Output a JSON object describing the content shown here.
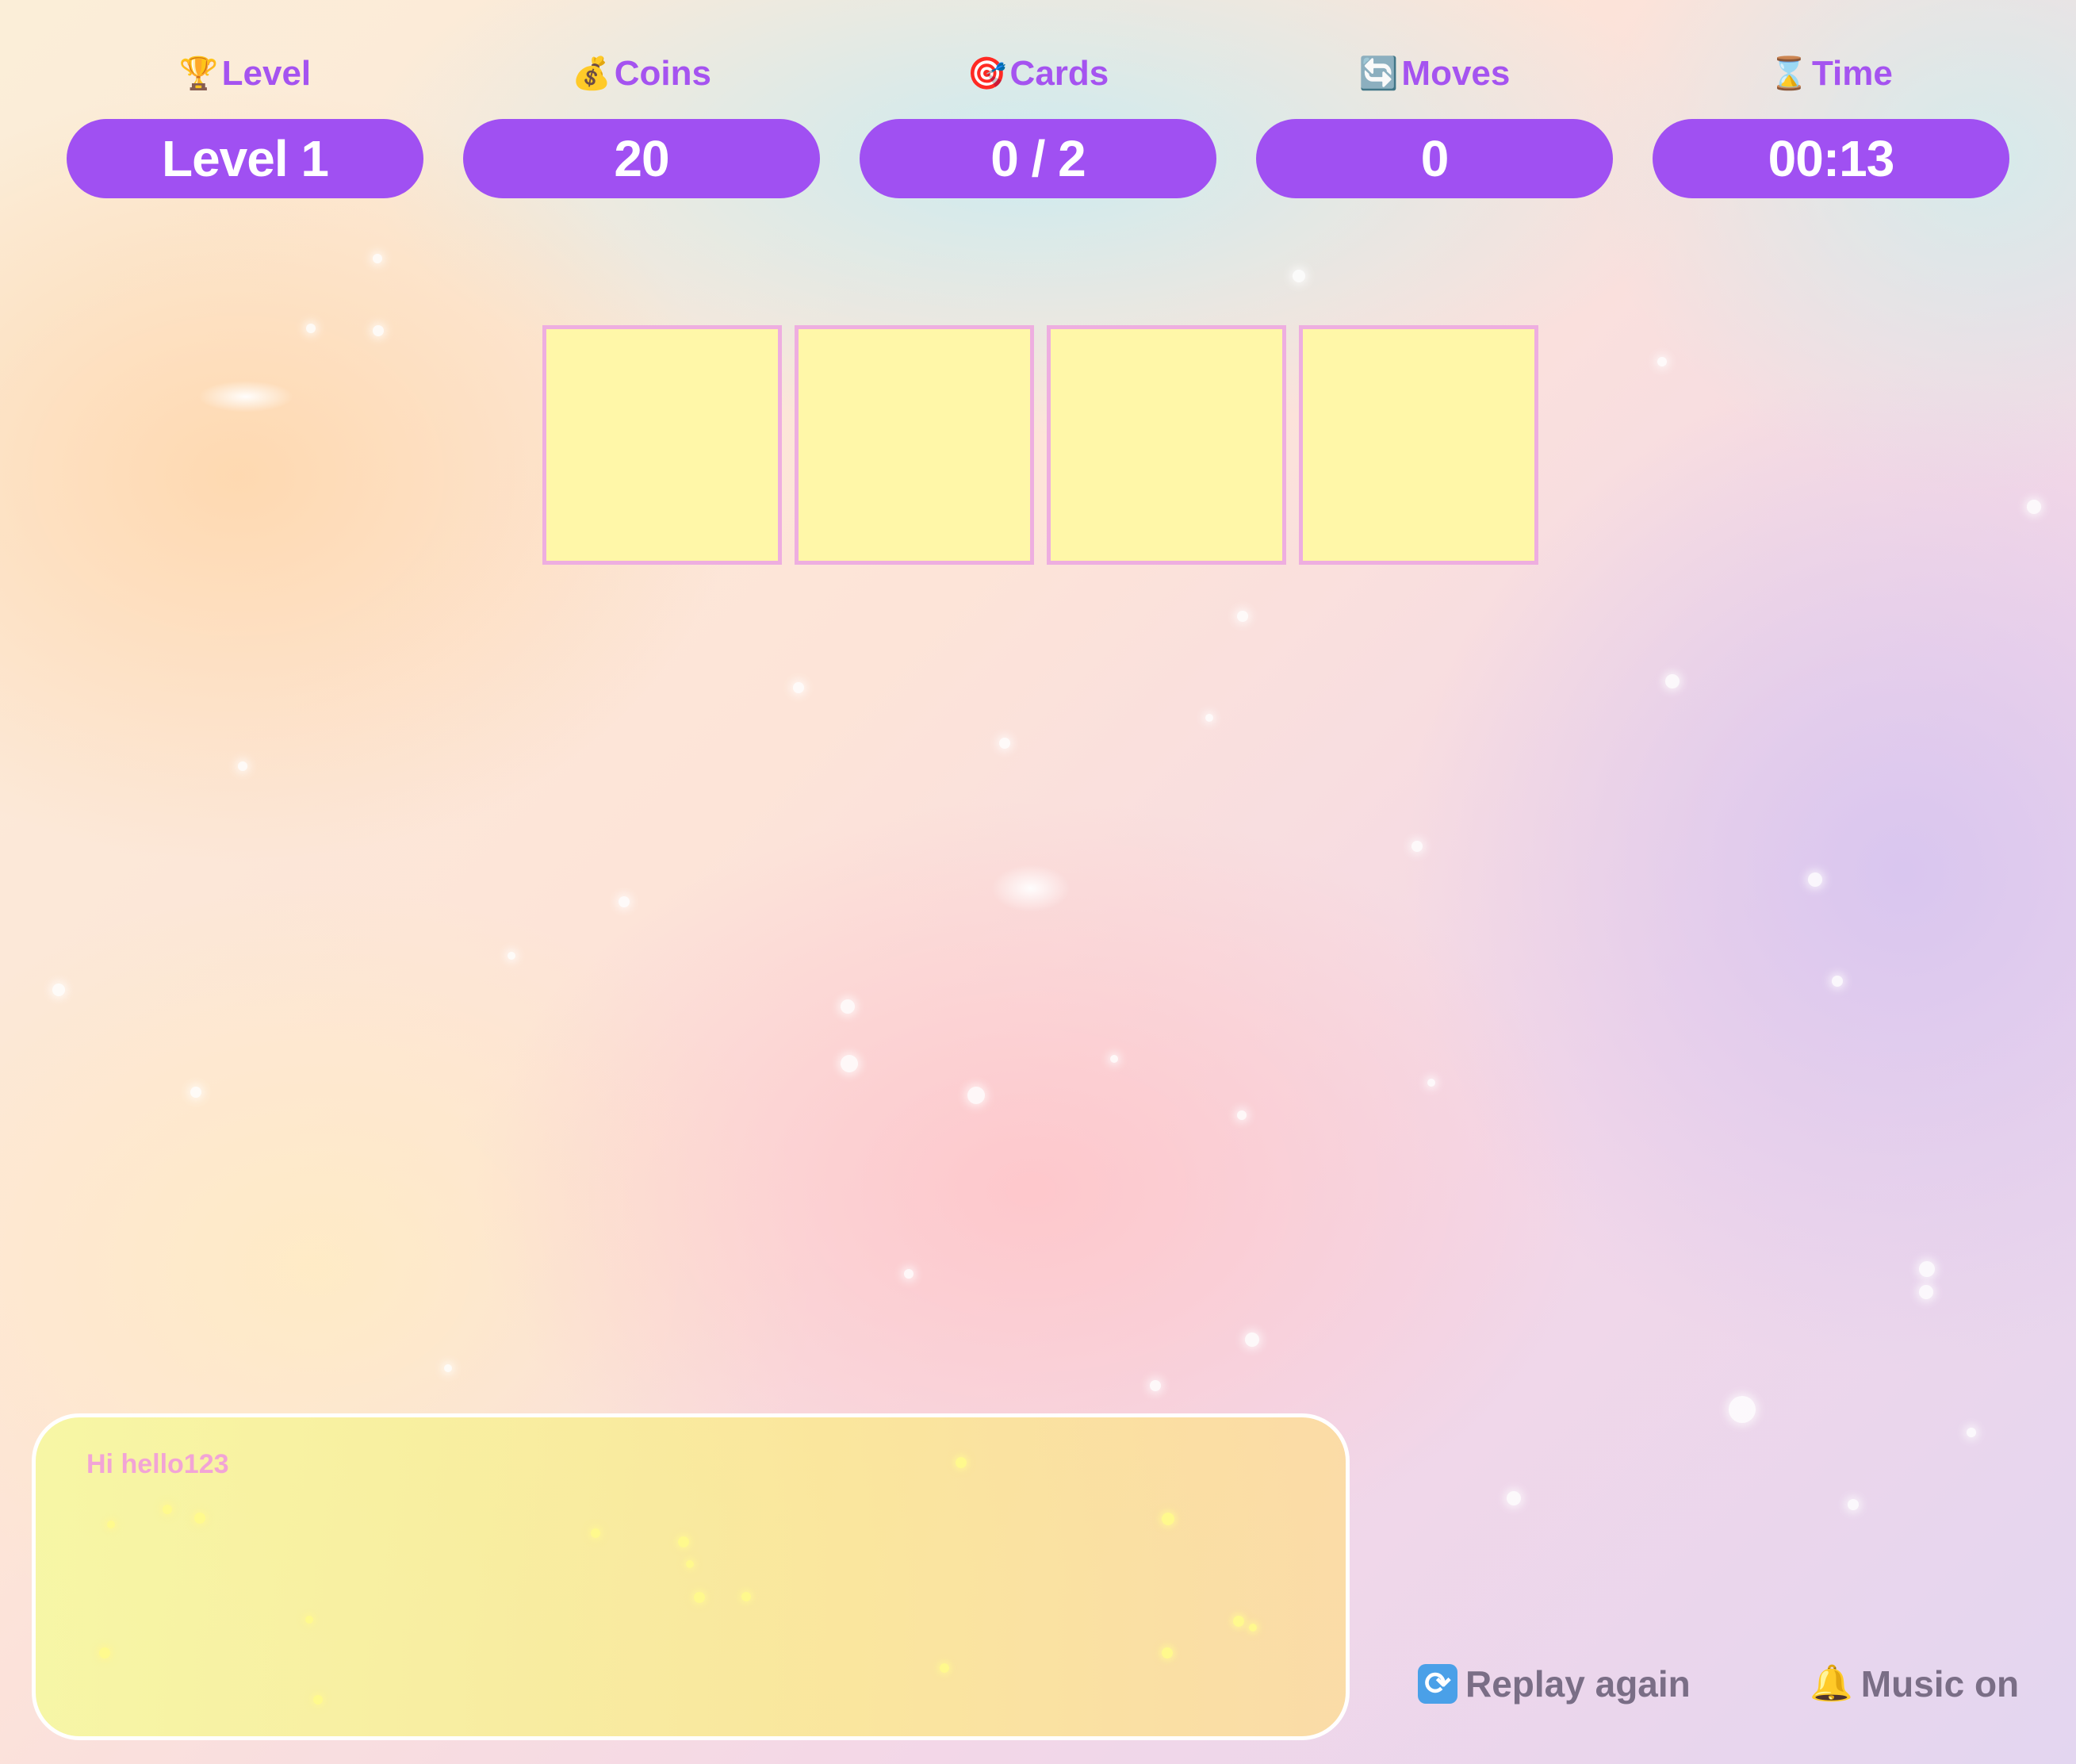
{
  "hud": {
    "level": {
      "label": "Level",
      "icon": "trophy-icon",
      "value": "Level 1"
    },
    "coins": {
      "label": "Coins",
      "icon": "money-bag-icon",
      "value": "20"
    },
    "cards": {
      "label": "Cards",
      "icon": "target-icon",
      "value": "0 / 2"
    },
    "moves": {
      "label": "Moves",
      "icon": "refresh-icon",
      "value": "0"
    },
    "time": {
      "label": "Time",
      "icon": "hourglass-icon",
      "value": "00:13"
    }
  },
  "board": {
    "card_count": 4,
    "card_color": "#fff7a8",
    "card_border": "#eeaee0"
  },
  "chat": {
    "message": "Hi hello123"
  },
  "controls": {
    "replay": {
      "label": "Replay again",
      "icon": "replay-icon"
    },
    "music": {
      "label": "Music on",
      "icon": "bell-icon"
    }
  },
  "colors": {
    "accent": "#a050f2",
    "label": "#a553f0",
    "control_text": "#7a6e86",
    "chat_text": "#f2a4d6"
  }
}
